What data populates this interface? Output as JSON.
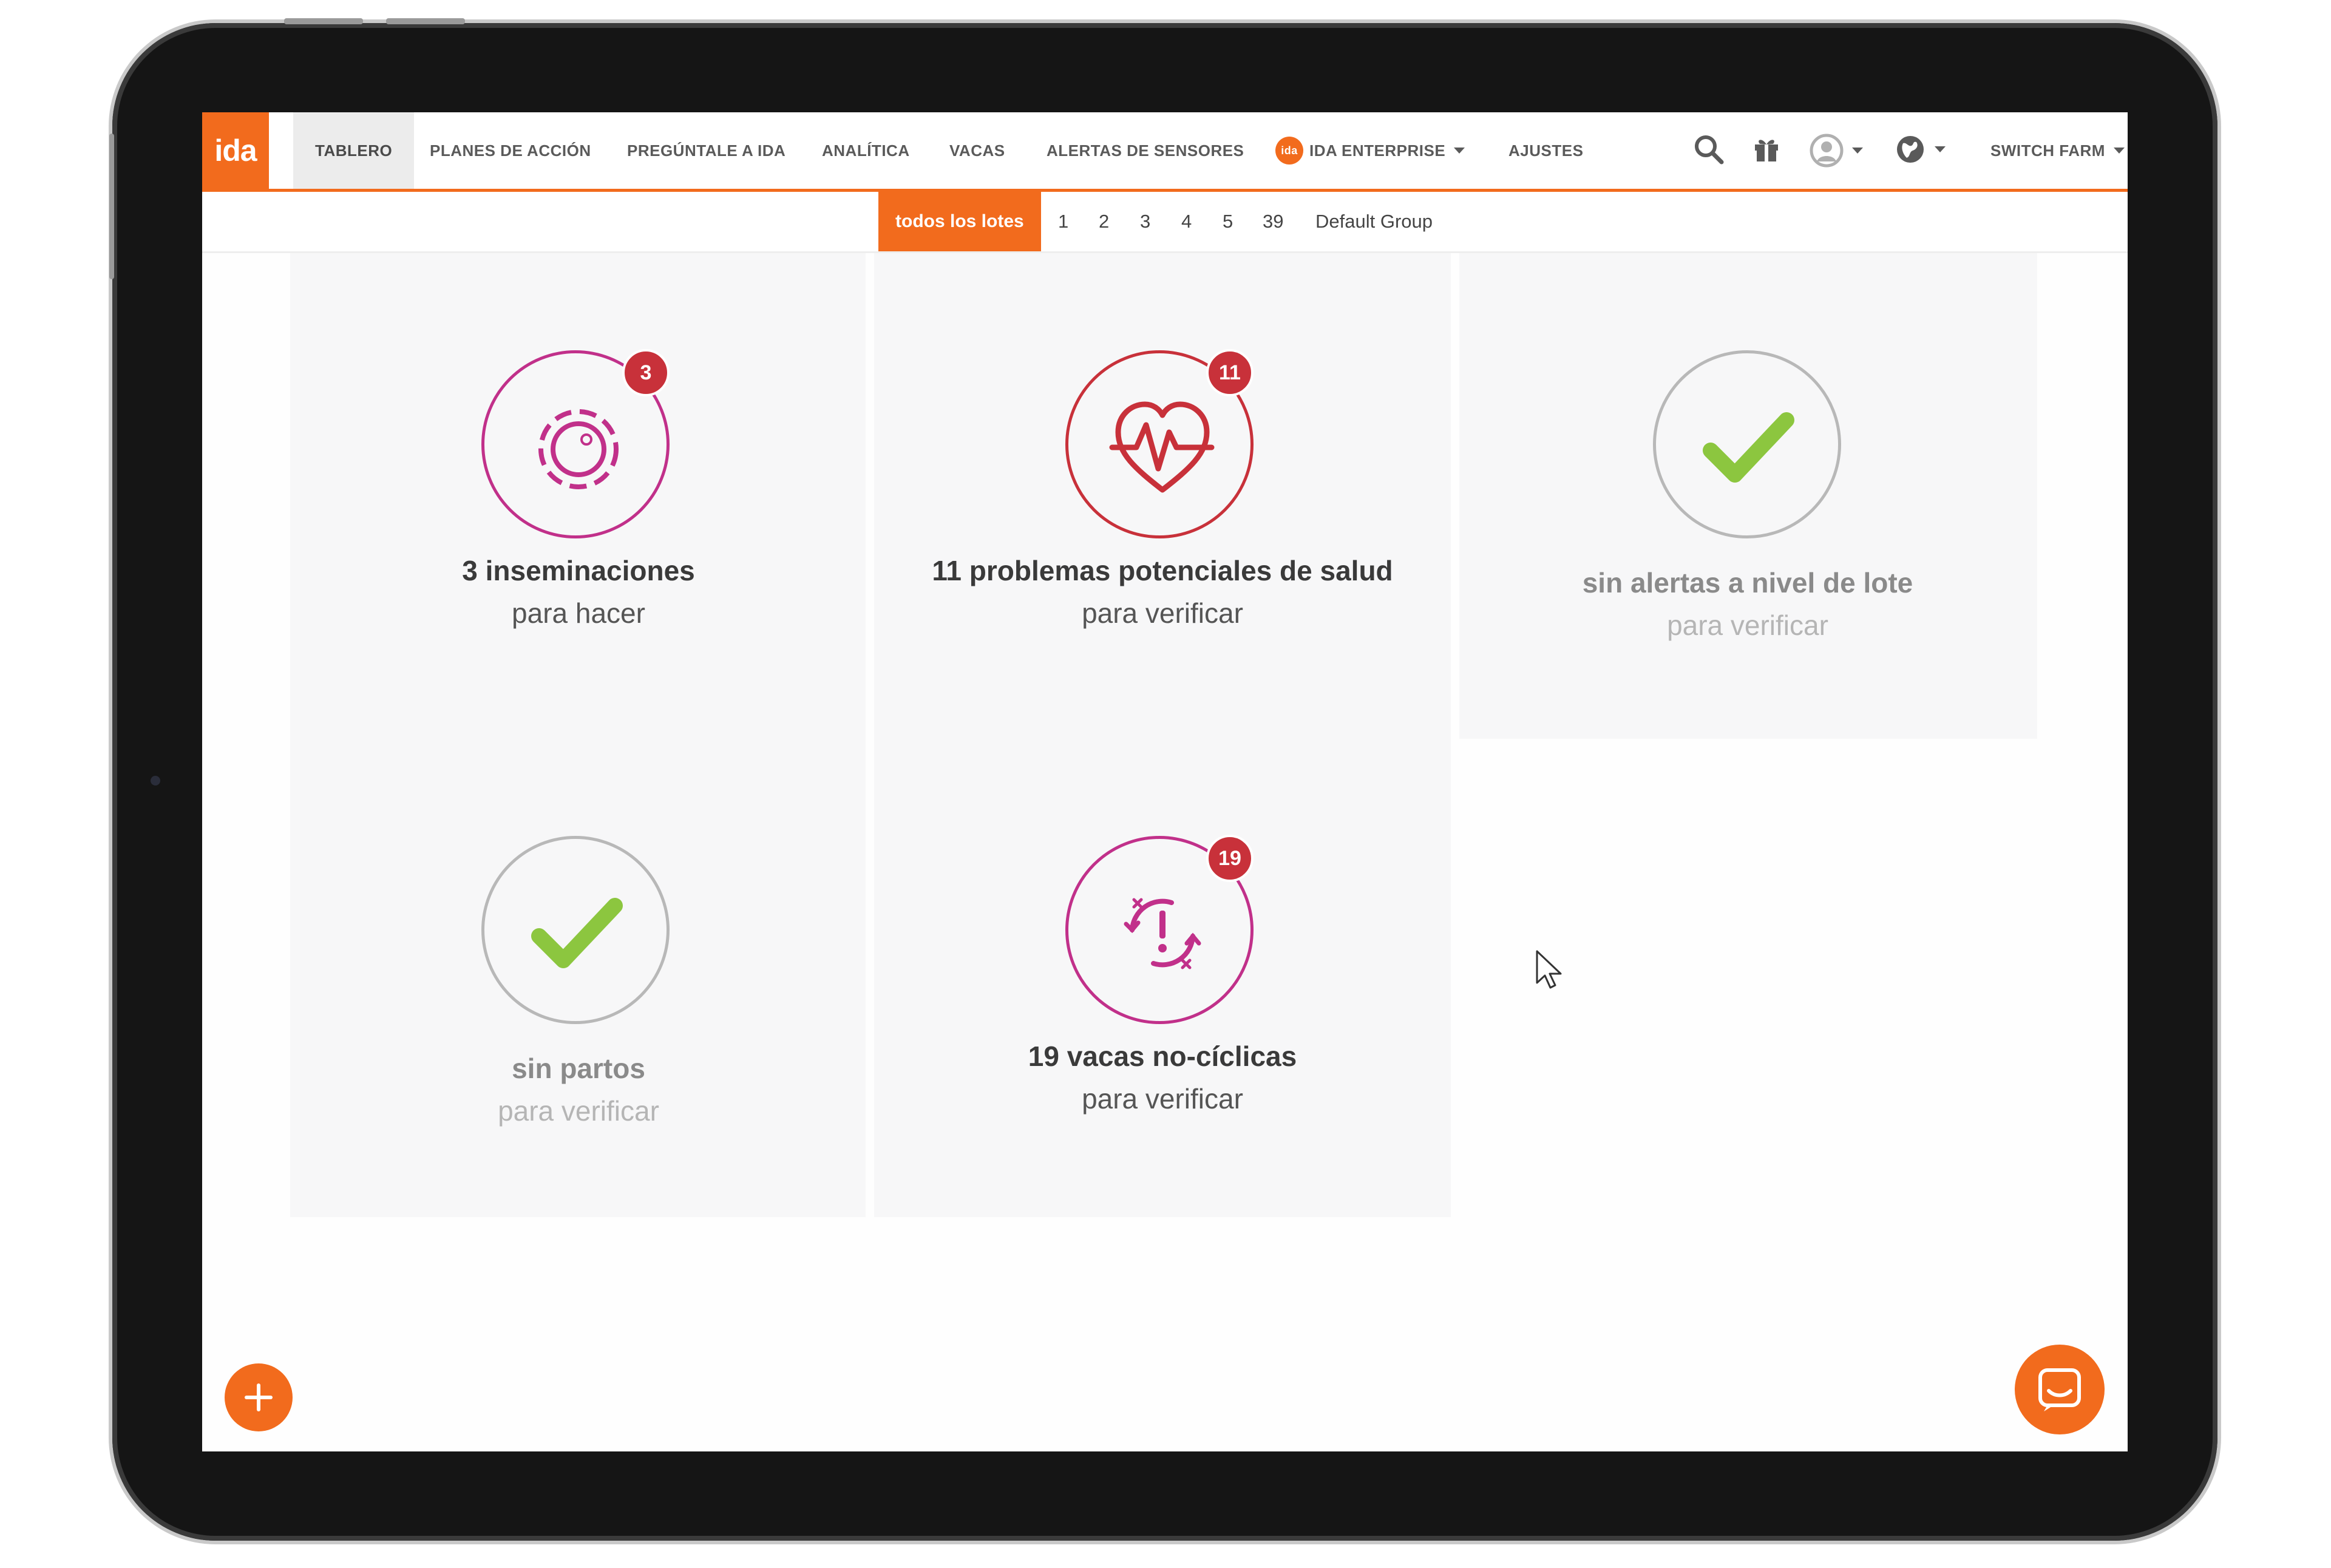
{
  "logo": "ida",
  "nav": {
    "items": [
      {
        "label": "TABLERO"
      },
      {
        "label": "PLANES DE ACCIÓN"
      },
      {
        "label": "PREGÚNTALE A IDA"
      },
      {
        "label": "ANALÍTICA"
      },
      {
        "label": "VACAS"
      },
      {
        "label": "ALERTAS DE SENSORES"
      },
      {
        "label": "IDA ENTERPRISE",
        "badge": "ida"
      },
      {
        "label": "AJUSTES"
      }
    ],
    "switch_farm": "SWITCH FARM"
  },
  "icons": {
    "search": "search-icon",
    "gift": "gift-icon",
    "user": "user-avatar-icon",
    "globe": "globe-icon"
  },
  "lots": {
    "active": "todos los lotes",
    "items": [
      "1",
      "2",
      "3",
      "4",
      "5",
      "39",
      "Default Group"
    ]
  },
  "cards": [
    {
      "title": "3 inseminaciones",
      "subtitle": "para hacer",
      "badge": "3",
      "icon": "insemination-icon",
      "color": "#c1308a"
    },
    {
      "title": "11 problemas potenciales de salud",
      "subtitle": "para verificar",
      "badge": "11",
      "icon": "heart-pulse-icon",
      "color": "#c8313a"
    },
    {
      "title": "sin alertas a nivel de lote",
      "subtitle": "para verificar",
      "icon": "checkmark-icon",
      "color": "#8cc63f"
    },
    {
      "title": "sin partos",
      "subtitle": "para verificar",
      "icon": "checkmark-icon",
      "color": "#8cc63f"
    },
    {
      "title": "19 vacas no-cíclicas",
      "subtitle": "para verificar",
      "badge": "19",
      "icon": "cycle-alert-icon",
      "color": "#c1308a"
    }
  ],
  "colors": {
    "accent": "#f26b1d",
    "badge": "#c8313a",
    "check": "#8cc63f",
    "magenta": "#c1308a"
  }
}
